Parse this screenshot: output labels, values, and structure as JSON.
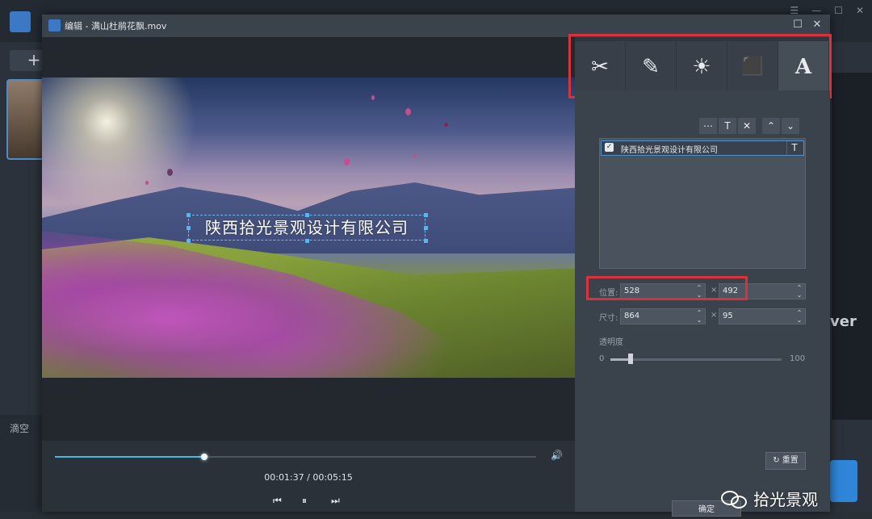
{
  "background": {
    "plus_label": "+",
    "right_text": "ver",
    "bottom_label": "滴空",
    "win_ctrls": [
      "☰",
      "—",
      "☐",
      "✕"
    ]
  },
  "dialog": {
    "title": "编辑 - 满山杜鹃花飘.mov",
    "maximize_icon": "☐",
    "close_icon": "✕"
  },
  "tools": [
    {
      "name": "cut-tool",
      "icon": "scissors-icon",
      "glyph": "✂"
    },
    {
      "name": "effects-tool",
      "icon": "magic-wand-icon",
      "glyph": "✎"
    },
    {
      "name": "adjust-tool",
      "icon": "brightness-icon",
      "glyph": "☀"
    },
    {
      "name": "watermark-tool",
      "icon": "stamp-icon",
      "glyph": "⬛"
    },
    {
      "name": "text-tool",
      "icon": "text-icon",
      "glyph": "A"
    }
  ],
  "video": {
    "overlay_text": "陕西拾光景观设计有限公司"
  },
  "player": {
    "timecode": "00:01:37 / 00:05:15",
    "progress": 0.31,
    "volume_icon": "🔊",
    "prev_icon": "⏮",
    "pause_icon": "⏸",
    "next_icon": "⏭"
  },
  "text_list": {
    "toolbar": [
      "⋯",
      "T",
      "✕",
      "⌃",
      "⌄"
    ],
    "items": [
      {
        "label": "陕西拾光景观设计有限公司",
        "checked": true,
        "type_icon": "T"
      }
    ]
  },
  "fields": {
    "position_label": "位置:",
    "position_x": "528",
    "position_y": "492",
    "size_label": "尺寸:",
    "size_w": "864",
    "size_h": "95",
    "separator": "×",
    "opacity_label": "透明度",
    "opacity_min": "0",
    "opacity_max": "100",
    "opacity_value": 0.12
  },
  "buttons": {
    "reset": "重置",
    "ok": "确定"
  },
  "watermark": {
    "text": "拾光景观"
  },
  "colors": {
    "highlight": "#d8323b",
    "accent": "#49b8e0",
    "dialog_bg": "#2e353e",
    "panel_bg": "#3a424c"
  }
}
